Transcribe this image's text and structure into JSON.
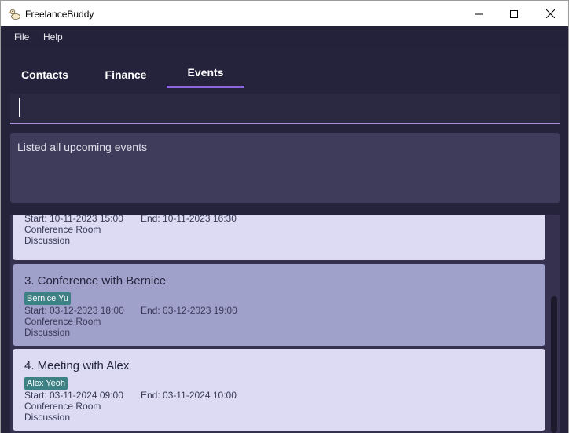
{
  "window": {
    "title": "FreelanceBuddy"
  },
  "menu": {
    "file": "File",
    "help": "Help"
  },
  "tabs": {
    "contacts": "Contacts",
    "finance": "Finance",
    "events": "Events"
  },
  "command": {
    "value": ""
  },
  "result": {
    "text": "Listed all upcoming events"
  },
  "events": [
    {
      "start": "Start: 10-11-2023 15:00",
      "end": "End: 10-11-2023 16:30",
      "location": "Conference Room",
      "description": "Discussion"
    },
    {
      "title": "3.  Conference with Bernice",
      "tag": "Bernice Yu",
      "start": "Start: 03-12-2023 18:00",
      "end": "End: 03-12-2023 19:00",
      "location": "Conference Room",
      "description": "Discussion"
    },
    {
      "title": "4.  Meeting with Alex",
      "tag": "Alex Yeoh",
      "start": "Start: 03-11-2024 09:00",
      "end": "End: 03-11-2024 10:00",
      "location": "Conference Room",
      "description": "Discussion"
    }
  ]
}
